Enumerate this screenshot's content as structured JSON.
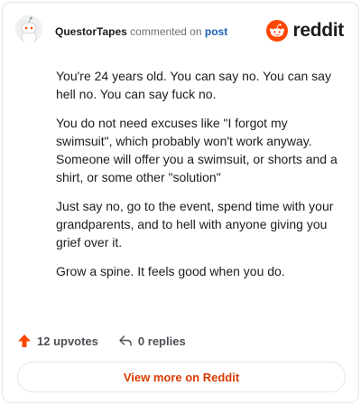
{
  "header": {
    "username": "QuestorTapes",
    "action_text": "commented on",
    "post_link": "post",
    "brand_name": "reddit",
    "brand_color": "#ff4500",
    "avatar_icon": "snoo-avatar-icon"
  },
  "comment": {
    "paragraphs": [
      "You're 24 years old. You can say no. You can say hell no. You can say fuck no.",
      "You do not need excuses like \"I forgot my swimsuit\", which probably won't work anyway. Someone will offer you a swimsuit, or shorts and a shirt, or some other \"solution\"",
      "Just say no, go to the event, spend time with your grandparents, and to hell with anyone giving you grief over it.",
      "Grow a spine. It feels good when you do."
    ]
  },
  "footer": {
    "upvotes_label": "12 upvotes",
    "replies_label": "0 replies",
    "upvote_color": "#ff4500"
  },
  "cta": {
    "label": "View more on Reddit",
    "color": "#d93a00"
  }
}
